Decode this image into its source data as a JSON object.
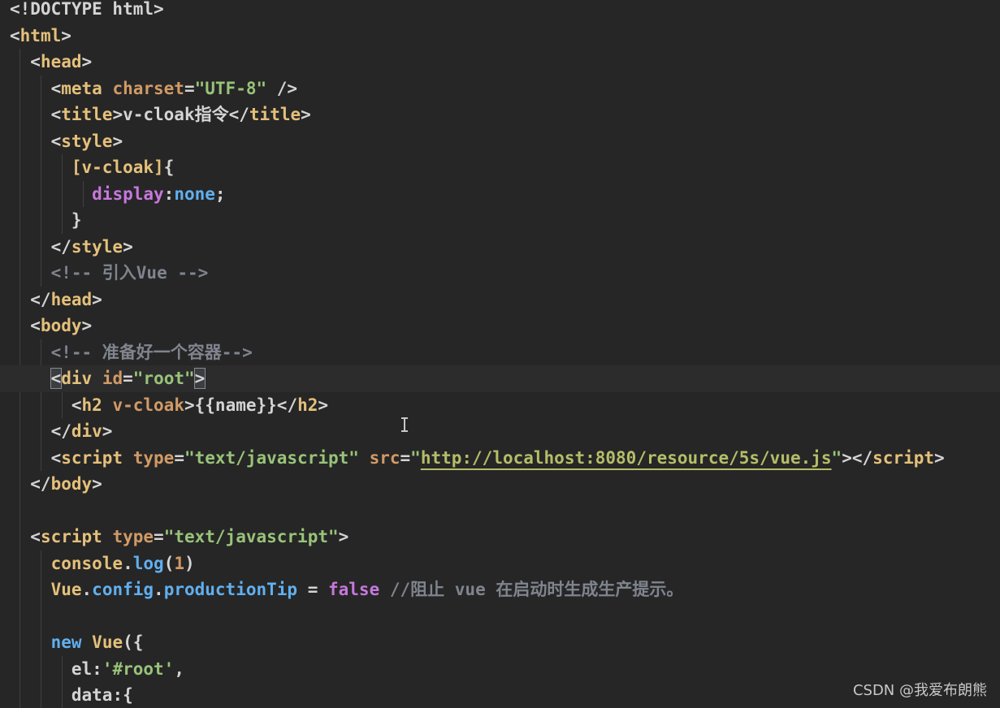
{
  "colors": {
    "background": "#262626",
    "tag": "#e5c07b",
    "attribute": "#d19a66",
    "string": "#98c379",
    "url": "#b5bd68",
    "comment": "#7f848e",
    "identifier": "#e5c07b",
    "method": "#61afef",
    "keyword": "#c678dd",
    "plain": "#d4d4d4",
    "punct": "#d4d4d4"
  },
  "editor": {
    "lines": [
      [
        {
          "t": "<!DOCTYPE html>",
          "c": "plain"
        }
      ],
      [
        {
          "t": "<",
          "c": "punct"
        },
        {
          "t": "html",
          "c": "tag"
        },
        {
          "t": ">",
          "c": "punct"
        }
      ],
      [
        {
          "t": "  <",
          "c": "punct"
        },
        {
          "t": "head",
          "c": "tag"
        },
        {
          "t": ">",
          "c": "punct"
        }
      ],
      [
        {
          "t": "    <",
          "c": "punct"
        },
        {
          "t": "meta",
          "c": "tag"
        },
        {
          "t": " ",
          "c": "plain"
        },
        {
          "t": "charset",
          "c": "attribute"
        },
        {
          "t": "=",
          "c": "punct"
        },
        {
          "t": "\"UTF-8\"",
          "c": "string"
        },
        {
          "t": " />",
          "c": "punct"
        }
      ],
      [
        {
          "t": "    <",
          "c": "punct"
        },
        {
          "t": "title",
          "c": "tag"
        },
        {
          "t": ">",
          "c": "punct"
        },
        {
          "t": "v-cloak指令",
          "c": "plain"
        },
        {
          "t": "</",
          "c": "punct"
        },
        {
          "t": "title",
          "c": "tag"
        },
        {
          "t": ">",
          "c": "punct"
        }
      ],
      [
        {
          "t": "    <",
          "c": "punct"
        },
        {
          "t": "style",
          "c": "tag"
        },
        {
          "t": ">",
          "c": "punct"
        }
      ],
      [
        {
          "t": "      ",
          "c": "plain"
        },
        {
          "t": "[v-cloak]",
          "c": "tag"
        },
        {
          "t": "{",
          "c": "punct"
        }
      ],
      [
        {
          "t": "        ",
          "c": "plain"
        },
        {
          "t": "display",
          "c": "keyword"
        },
        {
          "t": ":",
          "c": "punct"
        },
        {
          "t": "none",
          "c": "method"
        },
        {
          "t": ";",
          "c": "punct"
        }
      ],
      [
        {
          "t": "      }",
          "c": "punct"
        }
      ],
      [
        {
          "t": "    </",
          "c": "punct"
        },
        {
          "t": "style",
          "c": "tag"
        },
        {
          "t": ">",
          "c": "punct"
        }
      ],
      [
        {
          "t": "    <!-- 引入Vue -->",
          "c": "comment"
        }
      ],
      [
        {
          "t": "  </",
          "c": "punct"
        },
        {
          "t": "head",
          "c": "tag"
        },
        {
          "t": ">",
          "c": "punct"
        }
      ],
      [
        {
          "t": "  <",
          "c": "punct"
        },
        {
          "t": "body",
          "c": "tag"
        },
        {
          "t": ">",
          "c": "punct"
        }
      ],
      [
        {
          "t": "    <!-- 准备好一个容器-->",
          "c": "comment"
        }
      ],
      [
        {
          "t": "    ",
          "c": "plain"
        },
        {
          "t": "<",
          "c": "punct",
          "m": "bracket-match"
        },
        {
          "t": "div",
          "c": "tag"
        },
        {
          "t": " ",
          "c": "plain"
        },
        {
          "t": "id",
          "c": "attribute"
        },
        {
          "t": "=",
          "c": "punct"
        },
        {
          "t": "\"root\"",
          "c": "string"
        },
        {
          "t": ">",
          "c": "punct",
          "m": "bracket-match"
        }
      ],
      [
        {
          "t": "      <",
          "c": "punct"
        },
        {
          "t": "h2",
          "c": "tag"
        },
        {
          "t": " ",
          "c": "plain"
        },
        {
          "t": "v-cloak",
          "c": "attribute"
        },
        {
          "t": ">",
          "c": "punct"
        },
        {
          "t": "{{name}}",
          "c": "plain"
        },
        {
          "t": "</",
          "c": "punct"
        },
        {
          "t": "h2",
          "c": "tag"
        },
        {
          "t": ">",
          "c": "punct"
        }
      ],
      [
        {
          "t": "    </",
          "c": "punct"
        },
        {
          "t": "div",
          "c": "tag"
        },
        {
          "t": ">",
          "c": "punct"
        }
      ],
      [
        {
          "t": "    <",
          "c": "punct"
        },
        {
          "t": "script",
          "c": "tag"
        },
        {
          "t": " ",
          "c": "plain"
        },
        {
          "t": "type",
          "c": "attribute"
        },
        {
          "t": "=",
          "c": "punct"
        },
        {
          "t": "\"text/javascript\"",
          "c": "string"
        },
        {
          "t": " ",
          "c": "plain"
        },
        {
          "t": "src",
          "c": "attribute"
        },
        {
          "t": "=",
          "c": "punct"
        },
        {
          "t": "\"",
          "c": "string"
        },
        {
          "t": "http://localhost:8080/resource/5s/vue.js",
          "c": "url",
          "m": "url"
        },
        {
          "t": "\"",
          "c": "string"
        },
        {
          "t": "></",
          "c": "punct"
        },
        {
          "t": "script",
          "c": "tag"
        },
        {
          "t": ">",
          "c": "punct"
        }
      ],
      [
        {
          "t": "  </",
          "c": "punct"
        },
        {
          "t": "body",
          "c": "tag"
        },
        {
          "t": ">",
          "c": "punct"
        }
      ],
      [],
      [
        {
          "t": "  <",
          "c": "punct"
        },
        {
          "t": "script",
          "c": "tag"
        },
        {
          "t": " ",
          "c": "plain"
        },
        {
          "t": "type",
          "c": "attribute"
        },
        {
          "t": "=",
          "c": "punct"
        },
        {
          "t": "\"text/javascript\"",
          "c": "string"
        },
        {
          "t": ">",
          "c": "punct"
        }
      ],
      [
        {
          "t": "    ",
          "c": "plain"
        },
        {
          "t": "console",
          "c": "identifier"
        },
        {
          "t": ".",
          "c": "punct"
        },
        {
          "t": "log",
          "c": "method"
        },
        {
          "t": "(",
          "c": "punct"
        },
        {
          "t": "1",
          "c": "attribute"
        },
        {
          "t": ")",
          "c": "punct"
        }
      ],
      [
        {
          "t": "    ",
          "c": "plain"
        },
        {
          "t": "Vue",
          "c": "identifier"
        },
        {
          "t": ".",
          "c": "punct"
        },
        {
          "t": "config",
          "c": "method"
        },
        {
          "t": ".",
          "c": "punct"
        },
        {
          "t": "productionTip",
          "c": "method"
        },
        {
          "t": " = ",
          "c": "punct"
        },
        {
          "t": "false",
          "c": "keyword"
        },
        {
          "t": " //阻止 vue 在启动时生成生产提示。",
          "c": "comment"
        }
      ],
      [],
      [
        {
          "t": "    ",
          "c": "plain"
        },
        {
          "t": "new",
          "c": "method"
        },
        {
          "t": " ",
          "c": "plain"
        },
        {
          "t": "Vue",
          "c": "identifier"
        },
        {
          "t": "({",
          "c": "punct"
        }
      ],
      [
        {
          "t": "      ",
          "c": "plain"
        },
        {
          "t": "el",
          "c": "plain"
        },
        {
          "t": ":",
          "c": "punct"
        },
        {
          "t": "'#root'",
          "c": "string"
        },
        {
          "t": ",",
          "c": "punct"
        }
      ],
      [
        {
          "t": "      ",
          "c": "plain"
        },
        {
          "t": "data",
          "c": "plain"
        },
        {
          "t": ":",
          "c": "punct"
        },
        {
          "t": "{",
          "c": "punct"
        }
      ]
    ],
    "current_line": 14
  },
  "watermark": "CSDN @我爱布朗熊"
}
